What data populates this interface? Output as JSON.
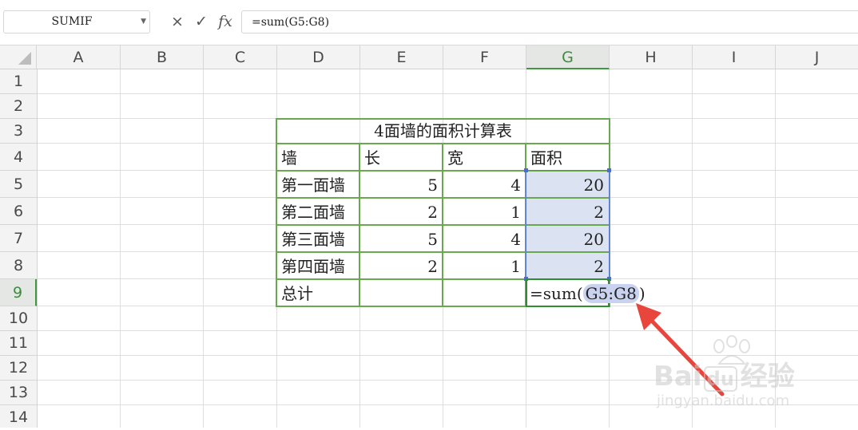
{
  "formula_bar": {
    "name_box": "SUMIF",
    "cancel_icon": "×",
    "enter_icon": "✓",
    "fx_label": "fx",
    "formula": "=sum(G5:G8)"
  },
  "columns": [
    "A",
    "B",
    "C",
    "D",
    "E",
    "F",
    "G",
    "H",
    "I",
    "J"
  ],
  "rows": [
    "1",
    "2",
    "3",
    "4",
    "5",
    "6",
    "7",
    "8",
    "9",
    "10",
    "11",
    "12",
    "13",
    "14"
  ],
  "table": {
    "title": "4面墙的面积计算表",
    "headers": [
      "墙",
      "长",
      "宽",
      "面积"
    ],
    "rows": [
      {
        "wall": "第一面墙",
        "length": "5",
        "width": "4",
        "area": "20"
      },
      {
        "wall": "第二面墙",
        "length": "2",
        "width": "1",
        "area": "2"
      },
      {
        "wall": "第三面墙",
        "length": "5",
        "width": "4",
        "area": "20"
      },
      {
        "wall": "第四面墙",
        "length": "2",
        "width": "1",
        "area": "2"
      }
    ],
    "total_label": "总计",
    "total_formula_prefix": "=sum(",
    "total_formula_ref": "G5:G8",
    "total_formula_suffix": ")"
  },
  "watermark": {
    "brand": "Bai",
    "brand_suffix": "du",
    "service": "经验",
    "url": "jingyan.baidu.com"
  },
  "colors": {
    "table_border": "#6aa84f",
    "selection": "#dbe3f3",
    "accent": "#3f9a3f",
    "arrow": "#e8453c"
  }
}
